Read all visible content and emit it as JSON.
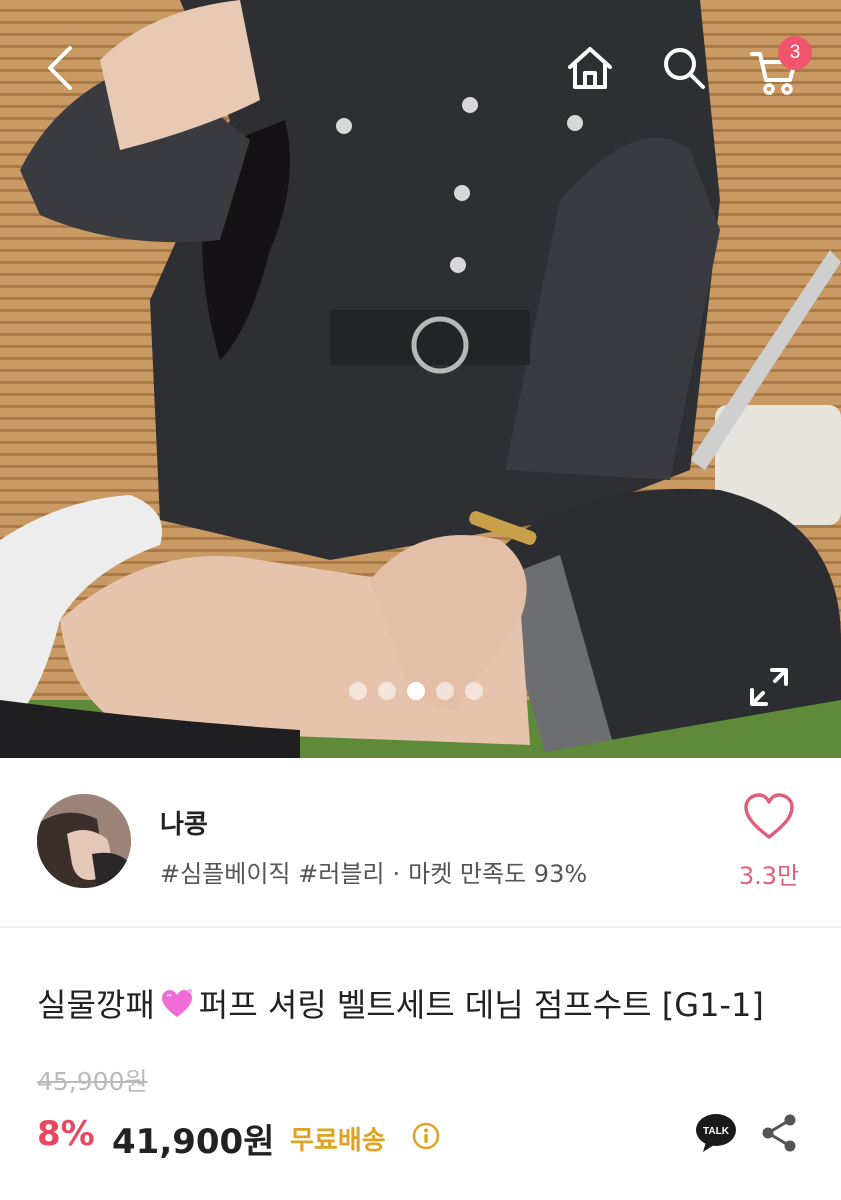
{
  "header": {
    "back_icon": "chevron-left-icon",
    "home_icon": "home-icon",
    "search_icon": "search-icon",
    "cart_icon": "cart-icon",
    "cart_count": "3"
  },
  "gallery": {
    "image_count": 5,
    "active_index": 2,
    "expand_icon": "expand-icon"
  },
  "seller": {
    "name": "나콩",
    "tags": "#심플베이직 #러블리",
    "separator": "·",
    "satisfaction": "마켓 만족도 93%",
    "like_icon": "heart-outline-icon",
    "like_count": "3.3만"
  },
  "product": {
    "title_prefix": "실물깡패",
    "title_emoji": "sparkling-heart-icon",
    "title_suffix": "퍼프 셔링 벨트세트 데님 점프수트 [G1-1]",
    "original_price": "45,900원",
    "discount": "8%",
    "price": "41,900원",
    "shipping": "무료배송",
    "info_icon": "info-icon",
    "talk_label": "TALK",
    "share_icon": "share-icon"
  },
  "colors": {
    "accent": "#e8485f",
    "badge": "#f0556d",
    "heart": "#e0607a",
    "shipping": "#e0a321"
  }
}
